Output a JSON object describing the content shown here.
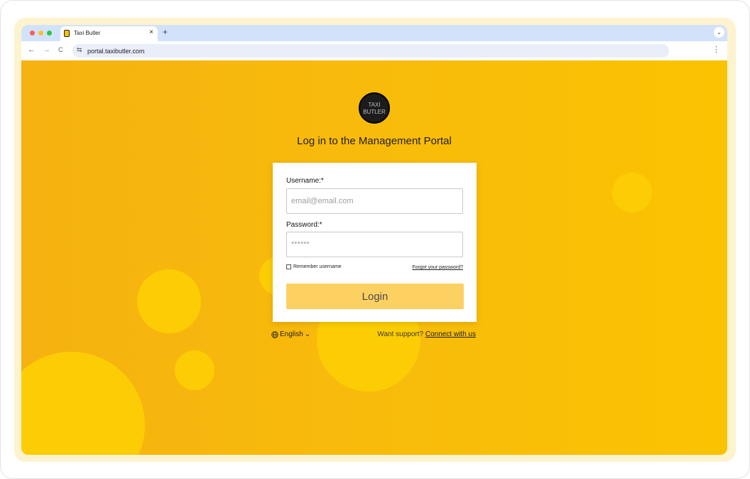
{
  "browser": {
    "tab_title": "Taxi Butler",
    "tab_close": "×",
    "new_tab": "+",
    "tabbar_menu": "⌄",
    "nav_back": "←",
    "nav_forward": "→",
    "nav_reload": "C",
    "site_info_icon": "⇆",
    "url": "portal.taxibutler.com",
    "menu": "⋮"
  },
  "logo": {
    "line1": "TAXI",
    "line2": "BUTLER"
  },
  "page": {
    "heading": "Log in to the Management Portal"
  },
  "form": {
    "username_label": "Username:*",
    "username_placeholder": "email@email.com",
    "password_label": "Password:*",
    "password_placeholder": "******",
    "remember_label": "Remember username",
    "forgot_link": "Forgot your password?",
    "login_button": "Login"
  },
  "footer": {
    "language": "English",
    "language_chevron": "⌄",
    "support_text": "Want support?",
    "support_link": "Connect with us"
  },
  "colors": {
    "background": "#f7b512",
    "bubble": "#fccd04",
    "login_button": "#fdd062"
  }
}
